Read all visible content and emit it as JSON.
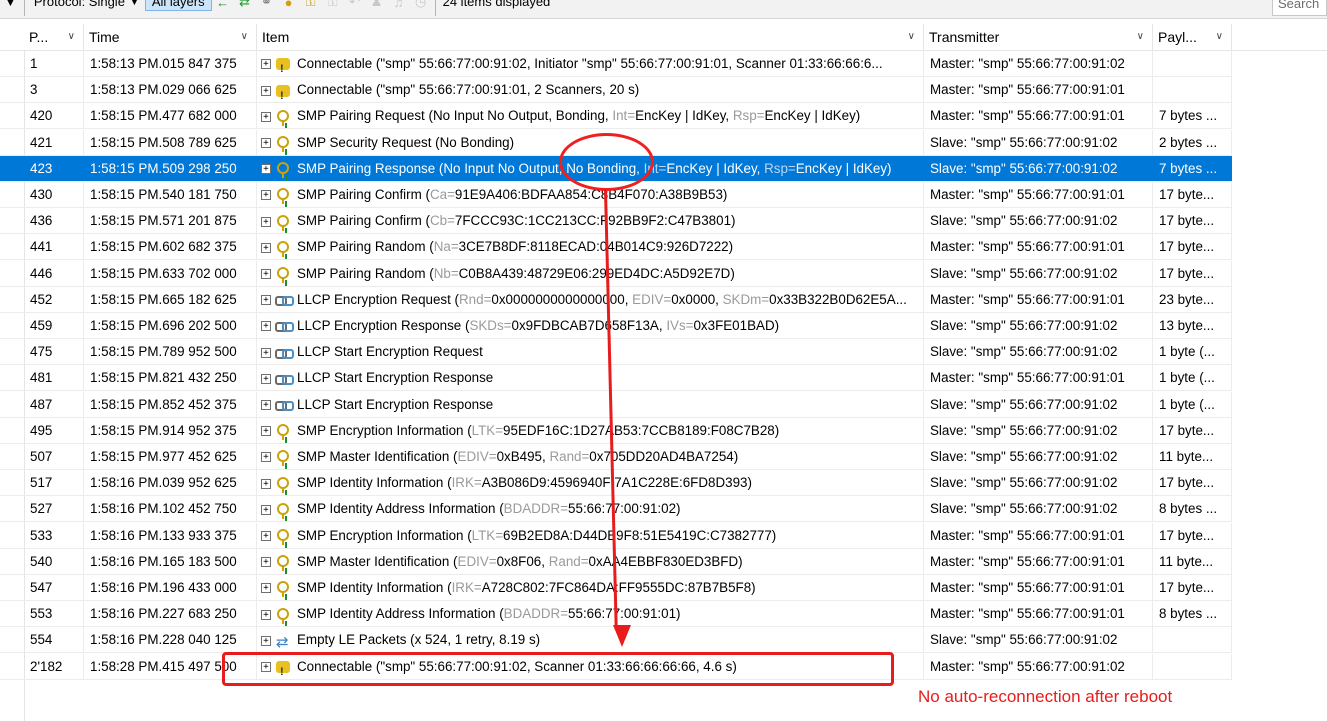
{
  "toolbar": {
    "filter_glyph": "▼",
    "protocol_label": "Protocol: Single",
    "layers_label": "All layers",
    "items_displayed": "24 items displayed",
    "search_placeholder": "Search"
  },
  "columns": {
    "packet": "P...",
    "time": "Time",
    "item": "Item",
    "transmitter": "Transmitter",
    "payload": "Payl..."
  },
  "rows": [
    {
      "pkt": "1",
      "time": "1:58:13 PM.015 847 375",
      "icon": "connectable-icon",
      "parts": [
        {
          "t": "Connectable (\"smp\" 55:66:77:00:91:02, Initiator \"smp\" 55:66:77:00:91:01, Scanner 01:33:66:66:6...",
          "g": false
        }
      ],
      "tx": "Master: \"smp\" 55:66:77:00:91:02",
      "pay": ""
    },
    {
      "pkt": "3",
      "time": "1:58:13 PM.029 066 625",
      "icon": "connectable-icon",
      "parts": [
        {
          "t": "Connectable (\"smp\" 55:66:77:00:91:01, 2 Scanners, 20 s)",
          "g": false
        }
      ],
      "tx": "Master: \"smp\" 55:66:77:00:91:01",
      "pay": ""
    },
    {
      "pkt": "420",
      "time": "1:58:15 PM.477 682 000",
      "icon": "key-icon",
      "parts": [
        {
          "t": "SMP Pairing Request (No Input No Output, Bonding, ",
          "g": false
        },
        {
          "t": "Int=",
          "g": true
        },
        {
          "t": "EncKey | IdKey, ",
          "g": false
        },
        {
          "t": "Rsp=",
          "g": true
        },
        {
          "t": "EncKey | IdKey)",
          "g": false
        }
      ],
      "tx": "Master: \"smp\" 55:66:77:00:91:01",
      "pay": "7 bytes ..."
    },
    {
      "pkt": "421",
      "time": "1:58:15 PM.508 789 625",
      "icon": "key-icon",
      "parts": [
        {
          "t": "SMP Security Request (No Bonding)",
          "g": false
        }
      ],
      "tx": "Slave: \"smp\" 55:66:77:00:91:02",
      "pay": "2 bytes ..."
    },
    {
      "pkt": "423",
      "time": "1:58:15 PM.509 298 250",
      "icon": "key-icon",
      "selected": true,
      "parts": [
        {
          "t": "SMP Pairing Response (No Input No Output, No Bonding, ",
          "g": false
        },
        {
          "t": "Int=",
          "g": true
        },
        {
          "t": "EncKey | IdKey, ",
          "g": false
        },
        {
          "t": "Rsp=",
          "g": true
        },
        {
          "t": "EncKey | IdKey)",
          "g": false
        }
      ],
      "tx": "Slave: \"smp\" 55:66:77:00:91:02",
      "pay": "7 bytes ..."
    },
    {
      "pkt": "430",
      "time": "1:58:15 PM.540 181 750",
      "icon": "key-icon",
      "parts": [
        {
          "t": "SMP Pairing Confirm (",
          "g": false
        },
        {
          "t": "Ca=",
          "g": true
        },
        {
          "t": "91E9A406:BDFAA854:C8B4F070:A38B9B53)",
          "g": false
        }
      ],
      "tx": "Master: \"smp\" 55:66:77:00:91:01",
      "pay": "17 byte..."
    },
    {
      "pkt": "436",
      "time": "1:58:15 PM.571 201 875",
      "icon": "key-icon",
      "parts": [
        {
          "t": "SMP Pairing Confirm (",
          "g": false
        },
        {
          "t": "Cb=",
          "g": true
        },
        {
          "t": "7FCCC93C:1CC213CC:F92BB9F2:C47B3801)",
          "g": false
        }
      ],
      "tx": "Slave: \"smp\" 55:66:77:00:91:02",
      "pay": "17 byte..."
    },
    {
      "pkt": "441",
      "time": "1:58:15 PM.602 682 375",
      "icon": "key-icon",
      "parts": [
        {
          "t": "SMP Pairing Random (",
          "g": false
        },
        {
          "t": "Na=",
          "g": true
        },
        {
          "t": "3CE7B8DF:8118ECAD:04B014C9:926D7222)",
          "g": false
        }
      ],
      "tx": "Master: \"smp\" 55:66:77:00:91:01",
      "pay": "17 byte..."
    },
    {
      "pkt": "446",
      "time": "1:58:15 PM.633 702 000",
      "icon": "key-icon",
      "parts": [
        {
          "t": "SMP Pairing Random (",
          "g": false
        },
        {
          "t": "Nb=",
          "g": true
        },
        {
          "t": "C0B8A439:48729E06:299ED4DC:A5D92E7D)",
          "g": false
        }
      ],
      "tx": "Slave: \"smp\" 55:66:77:00:91:02",
      "pay": "17 byte..."
    },
    {
      "pkt": "452",
      "time": "1:58:15 PM.665 182 625",
      "icon": "link-icon",
      "parts": [
        {
          "t": "LLCP Encryption Request (",
          "g": false
        },
        {
          "t": "Rnd=",
          "g": true
        },
        {
          "t": "0x0000000000000000, ",
          "g": false
        },
        {
          "t": "EDIV=",
          "g": true
        },
        {
          "t": "0x0000, ",
          "g": false
        },
        {
          "t": "SKDm=",
          "g": true
        },
        {
          "t": "0x33B322B0D62E5A...",
          "g": false
        }
      ],
      "tx": "Master: \"smp\" 55:66:77:00:91:01",
      "pay": "23 byte..."
    },
    {
      "pkt": "459",
      "time": "1:58:15 PM.696 202 500",
      "icon": "link-icon",
      "parts": [
        {
          "t": "LLCP Encryption Response (",
          "g": false
        },
        {
          "t": "SKDs=",
          "g": true
        },
        {
          "t": "0x9FDBCAB7D658F13A, ",
          "g": false
        },
        {
          "t": "IVs=",
          "g": true
        },
        {
          "t": "0x3FE01BAD)",
          "g": false
        }
      ],
      "tx": "Slave: \"smp\" 55:66:77:00:91:02",
      "pay": "13 byte..."
    },
    {
      "pkt": "475",
      "time": "1:58:15 PM.789 952 500",
      "icon": "link-icon",
      "parts": [
        {
          "t": "LLCP Start Encryption Request",
          "g": false
        }
      ],
      "tx": "Slave: \"smp\" 55:66:77:00:91:02",
      "pay": "1 byte (..."
    },
    {
      "pkt": "481",
      "time": "1:58:15 PM.821 432 250",
      "icon": "link-icon",
      "parts": [
        {
          "t": "LLCP Start Encryption Response",
          "g": false
        }
      ],
      "tx": "Master: \"smp\" 55:66:77:00:91:01",
      "pay": "1 byte (..."
    },
    {
      "pkt": "487",
      "time": "1:58:15 PM.852 452 375",
      "icon": "link-icon",
      "parts": [
        {
          "t": "LLCP Start Encryption Response",
          "g": false
        }
      ],
      "tx": "Slave: \"smp\" 55:66:77:00:91:02",
      "pay": "1 byte (..."
    },
    {
      "pkt": "495",
      "time": "1:58:15 PM.914 952 375",
      "icon": "key-icon",
      "parts": [
        {
          "t": "SMP Encryption Information (",
          "g": false
        },
        {
          "t": "LTK=",
          "g": true
        },
        {
          "t": "95EDF16C:1D27AB53:7CCB8189:F08C7B28)",
          "g": false
        }
      ],
      "tx": "Slave: \"smp\" 55:66:77:00:91:02",
      "pay": "17 byte..."
    },
    {
      "pkt": "507",
      "time": "1:58:15 PM.977 452 625",
      "icon": "key-icon",
      "parts": [
        {
          "t": "SMP Master Identification (",
          "g": false
        },
        {
          "t": "EDIV=",
          "g": true
        },
        {
          "t": "0xB495, ",
          "g": false
        },
        {
          "t": "Rand=",
          "g": true
        },
        {
          "t": "0x705DD20AD4BA7254)",
          "g": false
        }
      ],
      "tx": "Slave: \"smp\" 55:66:77:00:91:02",
      "pay": "11 byte..."
    },
    {
      "pkt": "517",
      "time": "1:58:16 PM.039 952 625",
      "icon": "key-icon",
      "parts": [
        {
          "t": "SMP Identity Information (",
          "g": false
        },
        {
          "t": "IRK=",
          "g": true
        },
        {
          "t": "A3B086D9:4596940F:7A1C228E:6FD8D393)",
          "g": false
        }
      ],
      "tx": "Slave: \"smp\" 55:66:77:00:91:02",
      "pay": "17 byte..."
    },
    {
      "pkt": "527",
      "time": "1:58:16 PM.102 452 750",
      "icon": "key-icon",
      "parts": [
        {
          "t": "SMP Identity Address Information (",
          "g": false
        },
        {
          "t": "BDADDR=",
          "g": true
        },
        {
          "t": "55:66:77:00:91:02)",
          "g": false
        }
      ],
      "tx": "Slave: \"smp\" 55:66:77:00:91:02",
      "pay": "8 bytes ..."
    },
    {
      "pkt": "533",
      "time": "1:58:16 PM.133 933 375",
      "icon": "key-icon",
      "parts": [
        {
          "t": "SMP Encryption Information (",
          "g": false
        },
        {
          "t": "LTK=",
          "g": true
        },
        {
          "t": "69B2ED8A:D44DB9F8:51E5419C:C7382777)",
          "g": false
        }
      ],
      "tx": "Master: \"smp\" 55:66:77:00:91:01",
      "pay": "17 byte..."
    },
    {
      "pkt": "540",
      "time": "1:58:16 PM.165 183 500",
      "icon": "key-icon",
      "parts": [
        {
          "t": "SMP Master Identification (",
          "g": false
        },
        {
          "t": "EDIV=",
          "g": true
        },
        {
          "t": "0x8F06, ",
          "g": false
        },
        {
          "t": "Rand=",
          "g": true
        },
        {
          "t": "0xAA4EBBF830ED3BFD)",
          "g": false
        }
      ],
      "tx": "Master: \"smp\" 55:66:77:00:91:01",
      "pay": "11 byte..."
    },
    {
      "pkt": "547",
      "time": "1:58:16 PM.196 433 000",
      "icon": "key-icon",
      "parts": [
        {
          "t": "SMP Identity Information (",
          "g": false
        },
        {
          "t": "IRK=",
          "g": true
        },
        {
          "t": "A728C802:7FC864DA:FF9555DC:87B7B5F8)",
          "g": false
        }
      ],
      "tx": "Master: \"smp\" 55:66:77:00:91:01",
      "pay": "17 byte..."
    },
    {
      "pkt": "553",
      "time": "1:58:16 PM.227 683 250",
      "icon": "key-icon",
      "parts": [
        {
          "t": "SMP Identity Address Information (",
          "g": false
        },
        {
          "t": "BDADDR=",
          "g": true
        },
        {
          "t": "55:66:77:00:91:01)",
          "g": false
        }
      ],
      "tx": "Master: \"smp\" 55:66:77:00:91:01",
      "pay": "8 bytes ..."
    },
    {
      "pkt": "554",
      "time": "1:58:16 PM.228 040 125",
      "icon": "empty-packets-icon",
      "parts": [
        {
          "t": "Empty LE Packets (x 524, 1 retry, 8.19 s)",
          "g": false
        }
      ],
      "tx": "Slave: \"smp\" 55:66:77:00:91:02",
      "pay": ""
    },
    {
      "pkt": "2'182",
      "time": "1:58:28 PM.415 497 500",
      "icon": "connectable-icon",
      "parts": [
        {
          "t": "Connectable (\"smp\" 55:66:77:00:91:02, Scanner 01:33:66:66:66:66, 4.6 s)",
          "g": false
        }
      ],
      "tx": "Master: \"smp\" 55:66:77:00:91:02",
      "pay": ""
    }
  ],
  "annotation": {
    "note": "No auto-reconnection after reboot",
    "color": "#e81c1c"
  },
  "colors": {
    "selection": "#0078d7",
    "label_gray": "#9a9a9a"
  }
}
